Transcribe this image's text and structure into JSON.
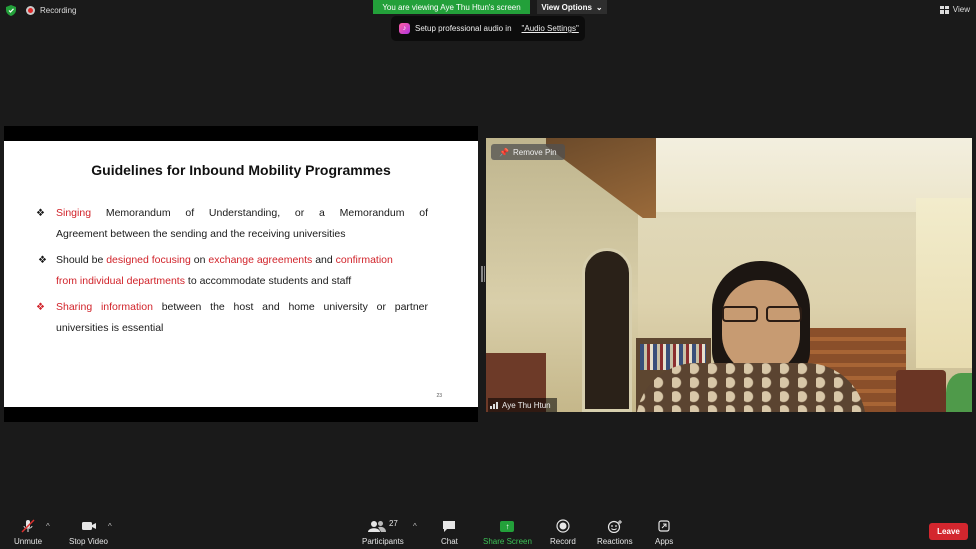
{
  "header": {
    "recording_label": "Recording",
    "viewing_banner": "You are viewing Aye Thu Htun's screen",
    "view_options_label": "View Options",
    "view_button_label": "View"
  },
  "audio_tip": {
    "text": "Setup professional audio in",
    "link": "\"Audio Settings\""
  },
  "slide": {
    "title": "Guidelines for Inbound Mobility Programmes",
    "bullet1": {
      "red1": "Singing",
      "text1": " Memorandum of Understanding, or a Memorandum of",
      "line2": "Agreement between the sending and the receiving universities"
    },
    "bullet2": {
      "t1": "Should be ",
      "r1": "designed focusing",
      "t2": " on ",
      "r2": "exchange agreements",
      "t3": " and ",
      "r3": "confirmation",
      "r4": "from individual departments",
      "t4": " to accommodate students and staff"
    },
    "bullet3": {
      "red1": "Sharing information",
      "text1": " between the host and home university or partner",
      "line2": "universities is essential"
    },
    "page_number": "23"
  },
  "video": {
    "remove_pin_label": "Remove Pin",
    "participant_name": "Aye Thu Htun"
  },
  "toolbar": {
    "unmute": "Unmute",
    "stop_video": "Stop Video",
    "participants": "Participants",
    "participants_count": "27",
    "chat": "Chat",
    "share_screen": "Share Screen",
    "record": "Record",
    "reactions": "Reactions",
    "apps": "Apps",
    "leave": "Leave"
  },
  "colors": {
    "banner_green": "#23a03a",
    "leave_red": "#d3262e",
    "slide_red": "#d1232a"
  }
}
